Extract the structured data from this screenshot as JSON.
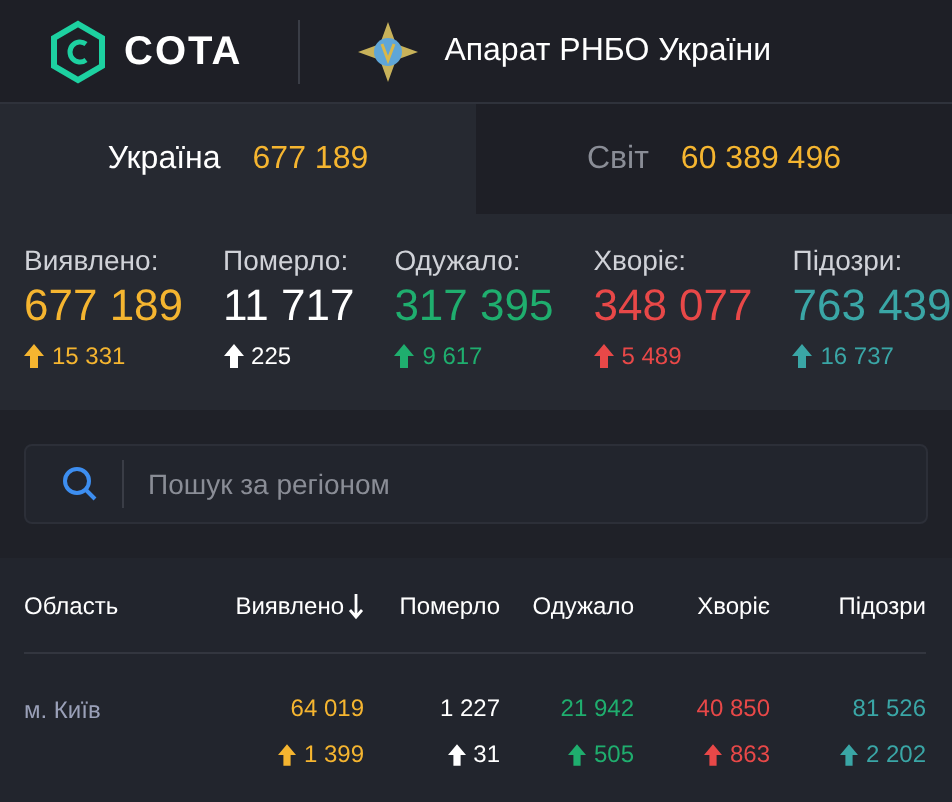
{
  "header": {
    "brand": "COTA",
    "org": "Апарат РНБО України"
  },
  "tabs": [
    {
      "label": "Україна",
      "value": "677 189",
      "selected": true
    },
    {
      "label": "Світ",
      "value": "60 389 496",
      "selected": false
    }
  ],
  "stats": [
    {
      "label": "Виявлено:",
      "value": "677 189",
      "delta": "15 331",
      "color": "#f5b530"
    },
    {
      "label": "Померло:",
      "value": "11 717",
      "delta": "225",
      "color": "#ffffff"
    },
    {
      "label": "Одужало:",
      "value": "317 395",
      "delta": "9 617",
      "color": "#1fae6e"
    },
    {
      "label": "Хворіє:",
      "value": "348 077",
      "delta": "5 489",
      "color": "#e84848"
    },
    {
      "label": "Підозри:",
      "value": "763 439",
      "delta": "16 737",
      "color": "#3aa6a6"
    }
  ],
  "search": {
    "placeholder": "Пошук за регіоном"
  },
  "table": {
    "columns": [
      {
        "label": "Область",
        "sorted": false
      },
      {
        "label": "Виявлено",
        "sorted": true
      },
      {
        "label": "Померло",
        "sorted": false
      },
      {
        "label": "Одужало",
        "sorted": false
      },
      {
        "label": "Хворіє",
        "sorted": false
      },
      {
        "label": "Підозри",
        "sorted": false
      }
    ],
    "rows": [
      {
        "cells": [
          {
            "kind": "region",
            "value": "м. Київ"
          },
          {
            "kind": "number",
            "value": "64 019",
            "delta": "1 399",
            "color": "#f5b530"
          },
          {
            "value": "1 227",
            "delta": "31",
            "color": "#ffffff"
          },
          {
            "value": "21 942",
            "delta": "505",
            "color": "#1fae6e"
          },
          {
            "value": "40 850",
            "delta": "863",
            "color": "#e84848"
          },
          {
            "value": "81 526",
            "delta": "2 202",
            "color": "#3aa6a6"
          }
        ]
      }
    ]
  }
}
